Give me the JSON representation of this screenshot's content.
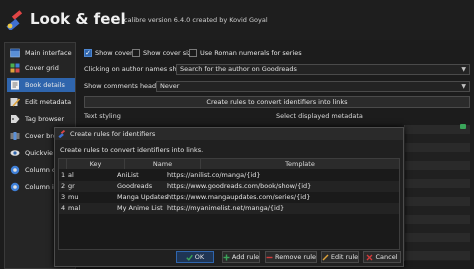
{
  "window": {
    "title": "Look & feel",
    "subtitle": "calibre version 6.4.0 created by Kovid Goyal"
  },
  "sidebar": {
    "items": [
      {
        "label": "Main interface",
        "icon": "window-icon",
        "active": false
      },
      {
        "label": "Cover grid",
        "icon": "grid-icon",
        "active": false
      },
      {
        "label": "Book details",
        "icon": "book-details-icon",
        "active": true
      },
      {
        "label": "Edit metadata",
        "icon": "edit-metadata-icon",
        "active": false
      },
      {
        "label": "Tag browser",
        "icon": "tag-icon",
        "active": false
      },
      {
        "label": "Cover bro",
        "icon": "cover-browser-icon",
        "active": false
      },
      {
        "label": "Quickvie",
        "icon": "quickview-icon",
        "active": false
      },
      {
        "label": "Column c",
        "icon": "column-icon",
        "active": false
      },
      {
        "label": "Column ic",
        "icon": "column-icon",
        "active": false
      }
    ]
  },
  "book_details": {
    "show_cover": {
      "label": "Show cover",
      "checked": true
    },
    "show_cover_size": {
      "label": "Show cover size",
      "checked": false
    },
    "roman_numerals": {
      "label": "Use Roman numerals for series",
      "checked": false
    },
    "author_click_label": "Clicking on author names should:",
    "author_click_value": "Search for the author on Goodreads",
    "comments_heading_label": "Show comments heading:",
    "comments_heading_value": "Never",
    "rules_button": "Create rules to convert identifiers into links",
    "text_styling_label": "Text styling",
    "select_metadata_label": "Select displayed metadata"
  },
  "dialog": {
    "title": "Create rules for identifiers",
    "description": "Create rules to convert identifiers into links.",
    "columns": [
      "Key",
      "Name",
      "Template"
    ],
    "rows": [
      {
        "num": "1",
        "key": "al",
        "name": "AniList",
        "template": "https://anilist.co/manga/{id}"
      },
      {
        "num": "2",
        "key": "gr",
        "name": "Goodreads",
        "template": "https://www.goodreads.com/book/show/{id}"
      },
      {
        "num": "3",
        "key": "mu",
        "name": "Manga Updates",
        "template": "https://www.mangaupdates.com/series/{id}"
      },
      {
        "num": "4",
        "key": "mal",
        "name": "My Anime List",
        "template": "https://myanimelist.net/manga/{id}"
      }
    ],
    "buttons": {
      "ok": "OK",
      "add_rule": "Add rule",
      "remove_rule": "Remove rule",
      "edit_rule": "Edit rule",
      "cancel": "Cancel"
    }
  },
  "colors": {
    "accent": "#2f65ad",
    "background": "#1c1c1c",
    "ok_green": "#3aa55a",
    "remove_red": "#d23b3b"
  }
}
